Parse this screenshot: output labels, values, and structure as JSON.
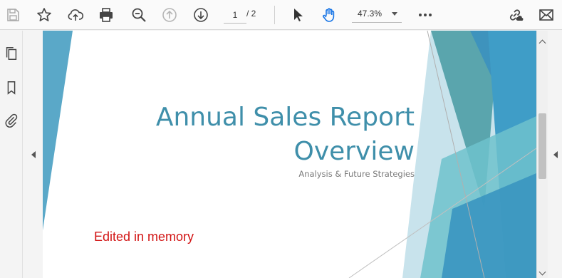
{
  "toolbar": {
    "icons": [
      "save-icon",
      "bookmark-star-icon",
      "upload-cloud-icon",
      "print-icon",
      "zoom-out-icon",
      "page-up-icon",
      "page-down-icon",
      "select-cursor-icon",
      "hand-tool-icon",
      "more-options-icon",
      "share-link-icon",
      "email-icon"
    ],
    "current_page": "1",
    "page_total": "/ 2",
    "zoom": "47.3%"
  },
  "sidebar": {
    "icons": [
      "pages-icon",
      "bookmark-icon",
      "attachment-icon"
    ]
  },
  "document": {
    "title": "Annual Sales Report\nOverview",
    "subtitle": "Analysis & Future Strategies",
    "annotation": "Edited in memory"
  },
  "colors": {
    "accent": "#3f8faa",
    "annotation": "#d21414",
    "hand_tool": "#1473e6"
  }
}
